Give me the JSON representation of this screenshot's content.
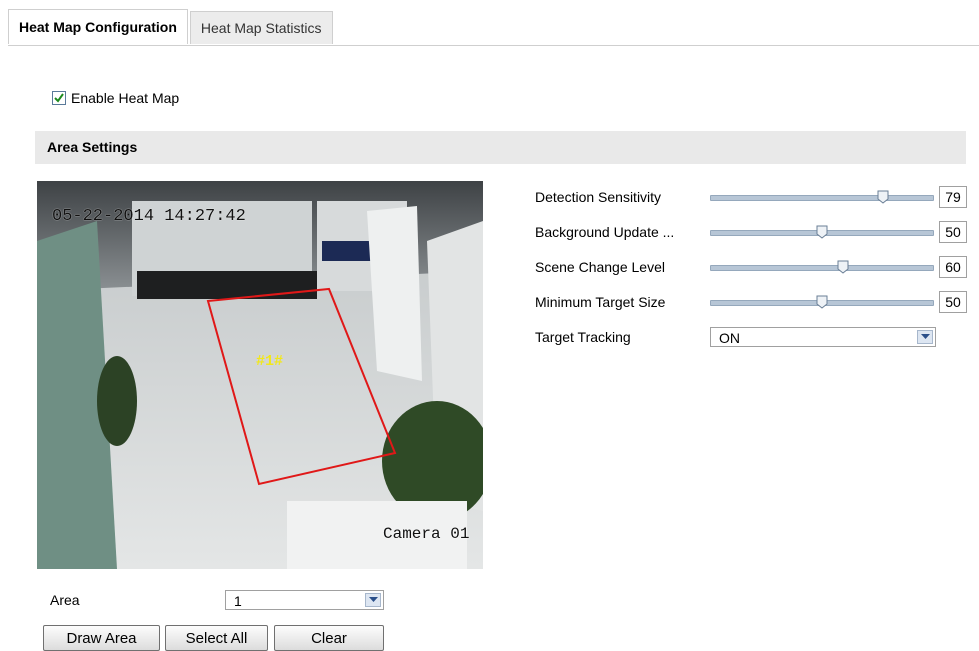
{
  "tabs": [
    {
      "label": "Heat Map Configuration",
      "active": true
    },
    {
      "label": "Heat Map Statistics",
      "active": false
    }
  ],
  "enable": {
    "label": "Enable Heat Map",
    "checked": true
  },
  "section": {
    "title": "Area Settings"
  },
  "video": {
    "timestamp": "05-22-2014 14:27:42",
    "camera_label": "Camera 01",
    "area_tag": "#1#"
  },
  "settings": [
    {
      "label": "Detection Sensitivity",
      "value": 79
    },
    {
      "label": "Background Update ...",
      "value": 50
    },
    {
      "label": "Scene Change Level",
      "value": 60
    },
    {
      "label": "Minimum Target Size",
      "value": 50
    }
  ],
  "tracking": {
    "label": "Target Tracking",
    "value": "ON"
  },
  "area": {
    "label": "Area",
    "value": "1"
  },
  "buttons": {
    "draw": "Draw Area",
    "select_all": "Select All",
    "clear": "Clear"
  },
  "colors": {
    "area_outline": "#e01818",
    "area_tag": "#f2e81a",
    "slider_track": "#b7c6d6"
  },
  "icons": {
    "checkbox": "check-icon",
    "dropdown": "chevron-down-icon",
    "slider_thumb": "slider-thumb-icon"
  }
}
